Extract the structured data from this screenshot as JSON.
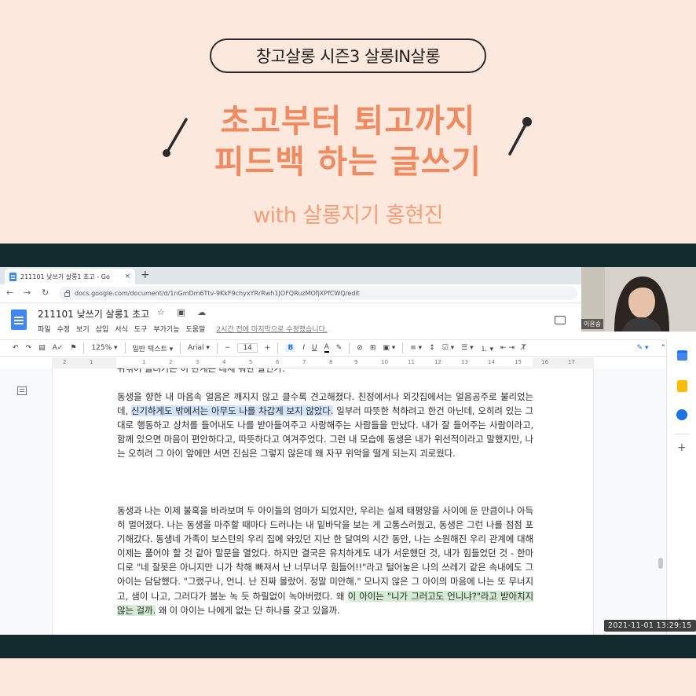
{
  "promo": {
    "series_pill": "창고살롱 시즌3 살롱IN살롱",
    "headline_line1": "초고부터 퇴고까지",
    "headline_line2": "피드백 하는 글쓰기",
    "byline": "with 살롱지기 홍현진"
  },
  "browser": {
    "tab_title": "211101 낮쓰기 살롱1 초고 - Go",
    "tab_close": "×",
    "new_tab": "+",
    "back": "←",
    "forward": "→",
    "reload": "↻",
    "url": "docs.google.com/document/d/1nGmDm6Ttv-9KkF9chyxYRrRwh1JOFQRuzMOfjXPfCWQ/edit"
  },
  "docs": {
    "title": "211101 낮쓰기 살롱1 초고",
    "title_icons": "☆ ▣ ☁",
    "menu": [
      "파일",
      "수정",
      "보기",
      "삽입",
      "서식",
      "도구",
      "부가기능",
      "도움말"
    ],
    "last_edit": "2시간 전에 마지막으로 수정했습니다.",
    "toolbar": {
      "undo": "↶",
      "redo": "↷",
      "print": "▤",
      "spell": "A✓",
      "paint": "⚑",
      "zoom": "125% ▾",
      "style": "일반 텍스트 ▾",
      "font": "Arial ▾",
      "size_minus": "−",
      "font_size": "14",
      "size_plus": "+",
      "bold": "B",
      "italic": "I",
      "underline": "U",
      "text_color": "A",
      "highlight": "✎",
      "link": "⊘",
      "comment": "⊞",
      "image": "▣ ▾",
      "align": "≡ ▾",
      "line_spacing": "↕",
      "checklist": "☑ ▾",
      "bullets": "☰ ▾",
      "numbered": "⒈ ▾",
      "indent": "⇤ ⇥",
      "clear": "T̸",
      "edit_mode": "✎ ▾",
      "collapse": "⌃"
    },
    "ruler": [
      "2",
      "1",
      "1",
      "2",
      "3",
      "4",
      "5",
      "6",
      "7",
      "8",
      "9",
      "10",
      "11",
      "12",
      "13",
      "14",
      "15",
      "16",
      "17",
      "18"
    ],
    "cut_line": "뒤섞어 돌려가는 이 관계는 대체 뭐란 말인가.",
    "para1_before": "동생을 향한 내 마음속 얼음은 깨지지 않고 클수록 견고해졌다. 친정에서나 외갓집에서는 얼음공주로 불리었는데, ",
    "para1_highlight": "신기하게도 밖에서는 아무도 나를 차갑게 보지 않았다.",
    "para1_after": " 일부러 따뜻한 척하려고 한건 아닌데, 오히려 있는 그대로 행동하고 상처를 들어내도 나를 받아들여주고 사랑해주는 사람들을 만났다. 내가 잘 들어주는 사람이라고, 함께 있으면 마음이 편안하다고, 따뜻하다고 여겨주었다. 그런 내 모습에 동생은 내가 위선적이라고 말했지만, 나는 오히려 그 아이 앞에만 서면 진심은 그렇지 않은데 왜 자꾸 위악을 떨게 되는지 괴로웠다.",
    "para2_before": "동생과 나는 이제 불혹을 바라보며 두 아이들의 엄마가 되었지만, 우리는 실제 태평양을 사이에 둔 만큼이나 아득히 멀어졌다. 나는 동생을 마주할 때마다 드러나는 내 밑바닥을 보는 게 고통스러웠고, 동생은 그런 나를 점점 포기해갔다. 동생네 가족이 보스턴의 우리 집에 와있던 지난 한 달여의 시간 동안, 나는 소원해진 우리 관계에 대해 이제는 풀어야 할 것 같아 말문을 열었다. 하지만 결국은 유치하게도 내가 서운했던 것, 내가 힘들었던 것 - 한마디로 \"네 잘못은 아니지만 니가 착해 빠져서 난 너무너무 힘들어!!\"라고 털어놓은 나의 쓰레기 같은 속내에도 그 아이는 담담했다. \"그랬구나, 언니. 난 진짜 몰랐어. 정말 미안해.\" 모나지 않은 그 아이의 마음에 나는 또 무너지고, 샘이 나고, 그러다가 봄눈 녹 듯 하릴없이 녹아버렸다. 왜 ",
    "para2_highlight": "이 아이는 \"니가 그러고도 언니냐?\"라고 받아치지 않는 걸까.",
    "para2_after": " 왜 이 아이는 나에게 없는 단 하나를 갖고 있을까."
  },
  "video": {
    "participant_name": "이윤숭",
    "timestamp": "2021-11-01 13:29:15"
  },
  "colors": {
    "accent_orange": "#f08a60",
    "band": "#132a2e",
    "highlight_blue": "#d2e3fc",
    "highlight_green": "#d4ecd3"
  }
}
